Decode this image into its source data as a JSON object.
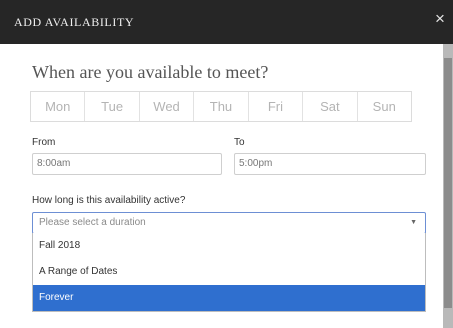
{
  "modal": {
    "title": "ADD AVAILABILITY",
    "close_glyph": "×",
    "question": "When are you available to meet?"
  },
  "days": [
    "Mon",
    "Tue",
    "Wed",
    "Thu",
    "Fri",
    "Sat",
    "Sun"
  ],
  "from": {
    "label": "From",
    "value": "8:00am"
  },
  "to": {
    "label": "To",
    "value": "5:00pm"
  },
  "duration": {
    "label": "How long is this availability active?",
    "placeholder": "Please select a duration",
    "caret_glyph": "▼",
    "options": [
      "Fall 2018",
      "A Range of Dates",
      "Forever"
    ],
    "highlighted": "Forever"
  },
  "icons": {
    "close": "close-icon",
    "caret": "chevron-down-icon"
  },
  "colors": {
    "titlebar": "#262626",
    "highlight": "#2f6fcf",
    "select_border": "#6d8fd4"
  }
}
